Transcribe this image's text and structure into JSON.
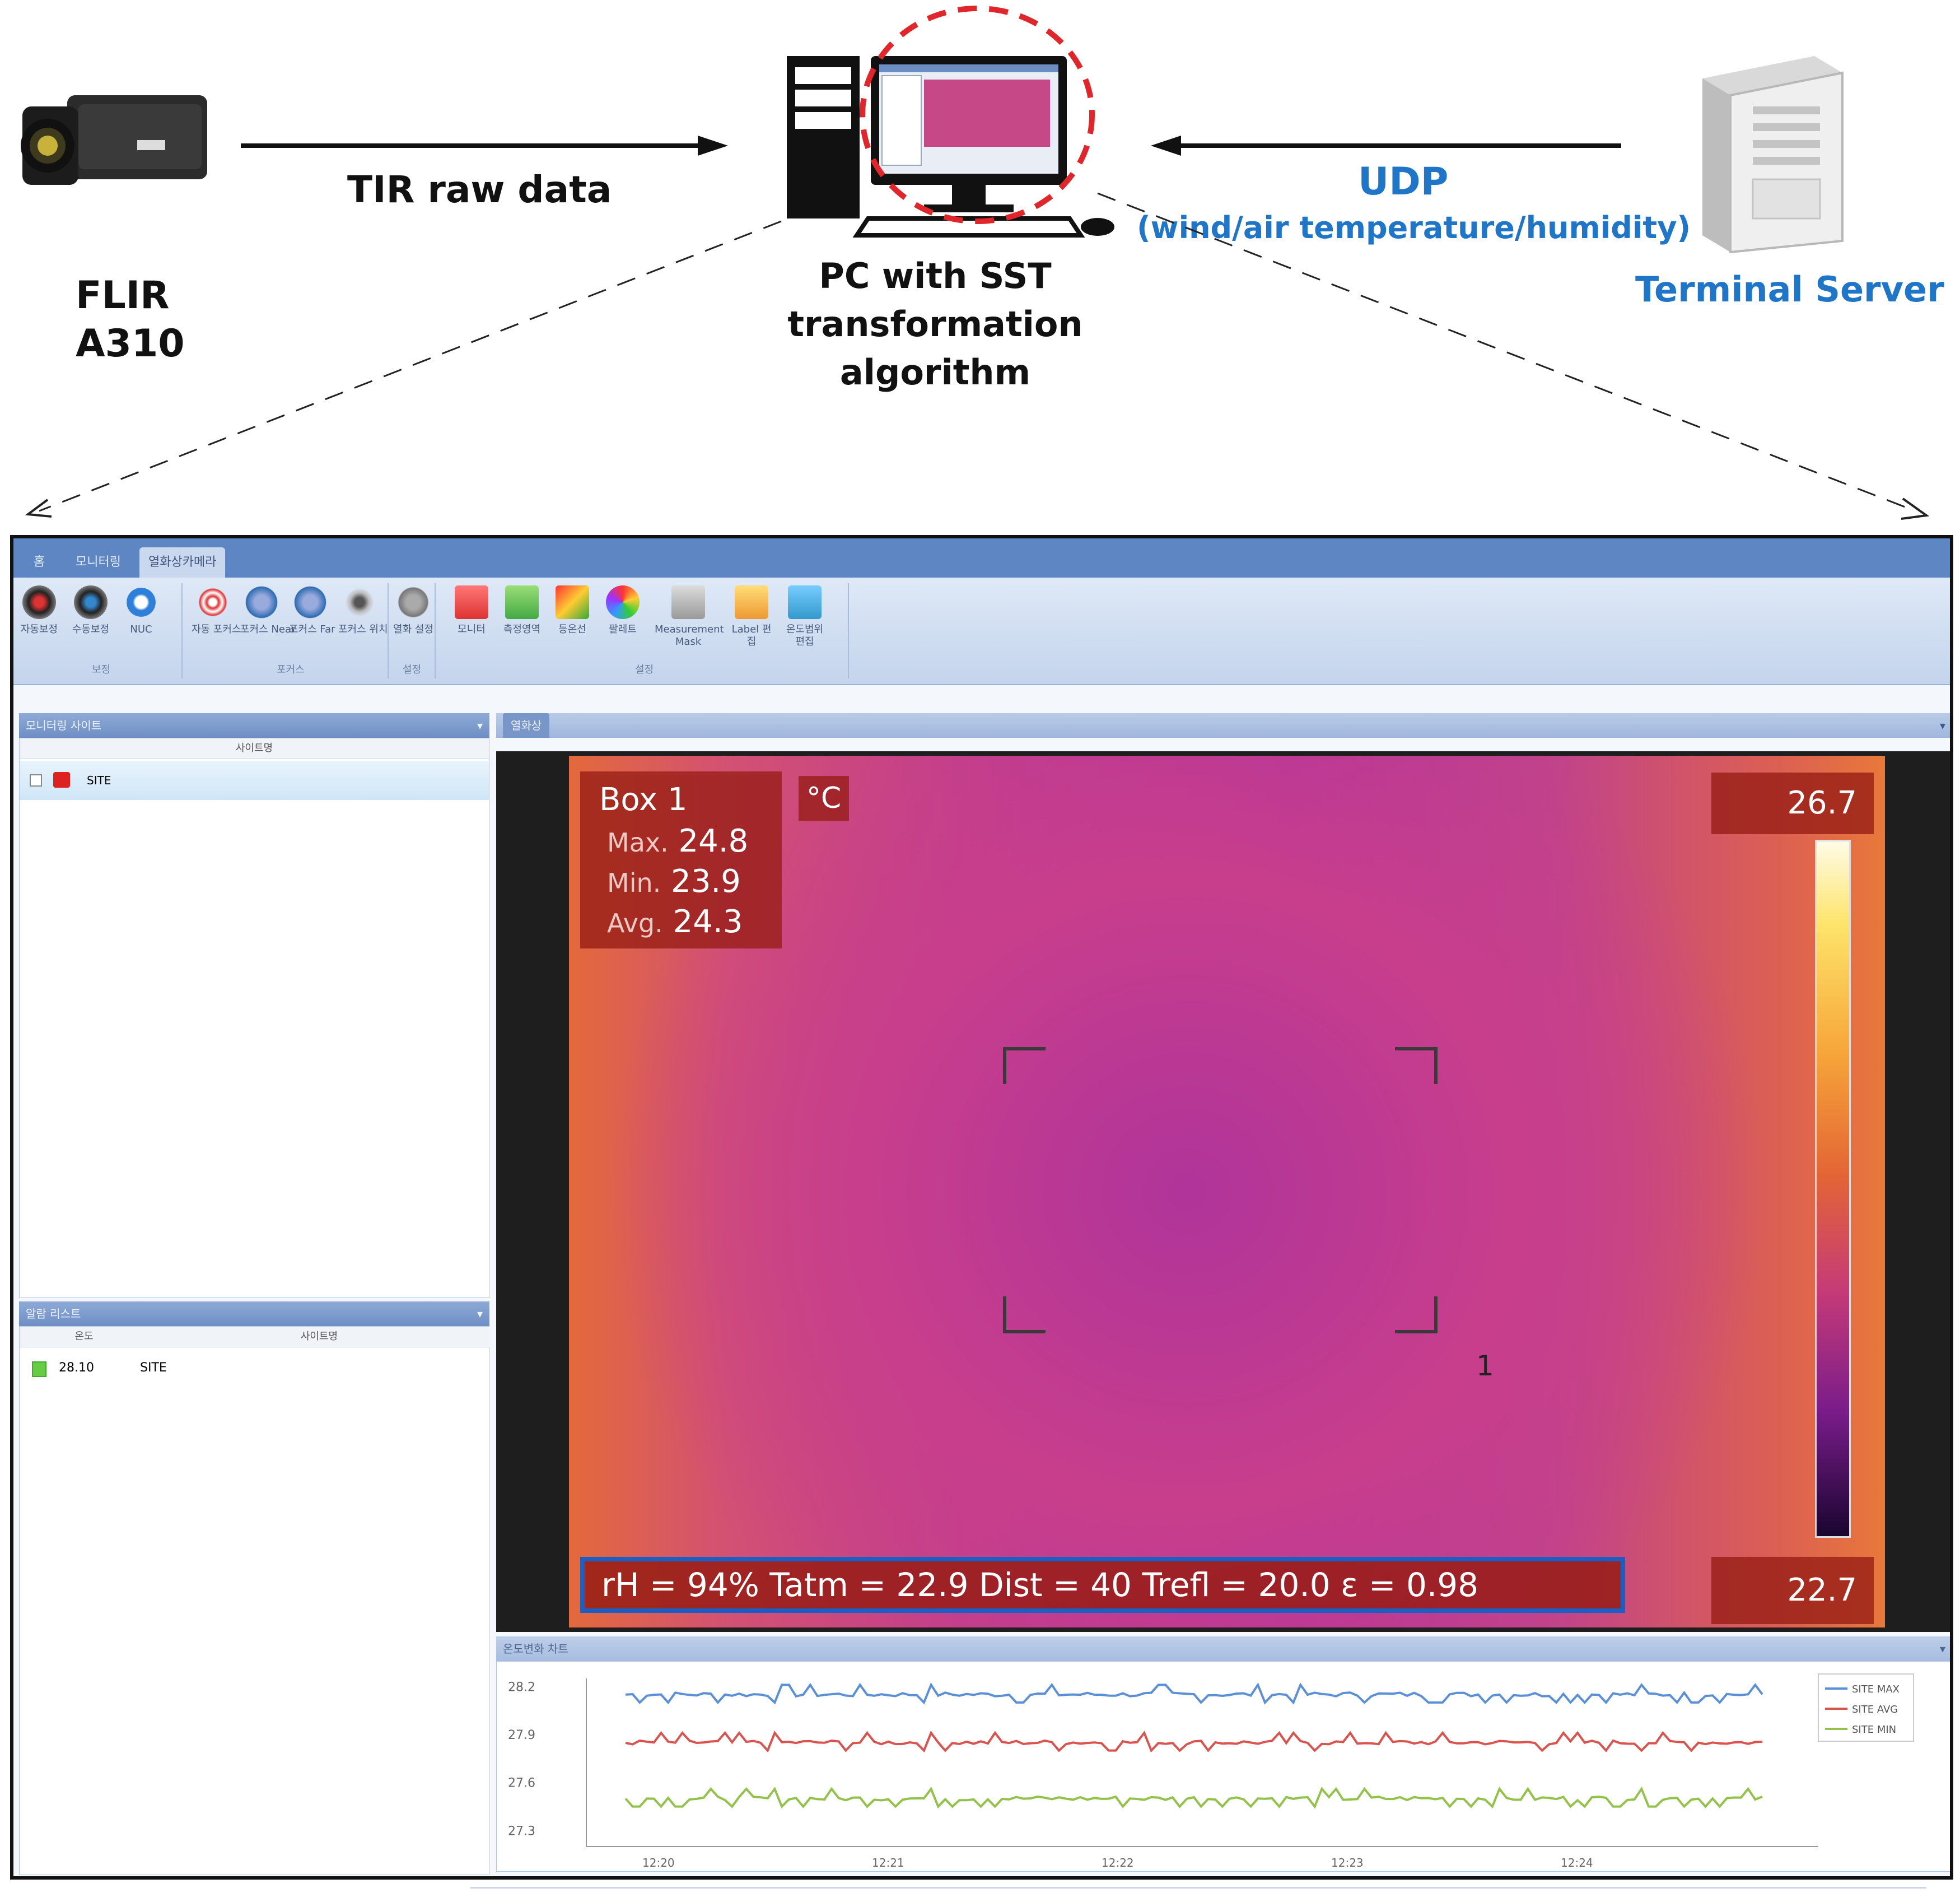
{
  "diagram": {
    "camera": {
      "name_line1": "FLIR",
      "name_line2": "A310"
    },
    "pc": {
      "line1": "PC with SST",
      "line2": "transformation",
      "line3": "algorithm"
    },
    "server": {
      "name": "Terminal Server"
    },
    "arrow_camera_to_pc": {
      "label": "TIR raw data"
    },
    "arrow_server_to_pc": {
      "label": "UDP",
      "sublabel": "(wind/air temperature/humidity)"
    }
  },
  "app": {
    "tabs": [
      "홈",
      "모니터링",
      "열화상카메라"
    ],
    "active_tab": 2,
    "ribbon": {
      "buttons": [
        "자동보정",
        "수동보정",
        "NUC",
        "자동 포커스",
        "포커스 Near",
        "포커스 Far",
        "포커스 위치",
        "열화 설정",
        "모니터",
        "측정영역",
        "등온선",
        "팔레트",
        "Measurement Mask",
        "Label 편집",
        "온도범위 편집"
      ],
      "groups": [
        "보정",
        "포커스",
        "설정",
        "설정"
      ]
    },
    "site_panel": {
      "title": "모니터링 사이트",
      "column": "사이트명",
      "rows": [
        {
          "name": "SITE"
        }
      ]
    },
    "alarm_panel": {
      "title": "알람 리스트",
      "columns": [
        "온도",
        "사이트명"
      ],
      "rows": [
        {
          "temp": "28.10",
          "site": "SITE"
        }
      ]
    },
    "view_tab": "열화상",
    "thermal": {
      "box_title": "Box 1",
      "unit": "°C",
      "max_label": "Max.",
      "max_value": "24.8",
      "min_label": "Min.",
      "min_value": "23.9",
      "avg_label": "Avg.",
      "avg_value": "24.3",
      "scale_max": "26.7",
      "scale_min": "22.7",
      "region_label": "1",
      "params": "rH = 94%  Tatm = 22.9  Dist = 40  Trefl = 20.0  ε = 0.98"
    },
    "trend_panel": {
      "title": "온도변화 차트"
    }
  },
  "chart_data": {
    "type": "line",
    "y_ticks": [
      "28.2",
      "27.9",
      "27.6",
      "27.3"
    ],
    "x_ticks": [
      "12:20",
      "12:21",
      "12:22",
      "12:23",
      "12:24"
    ],
    "legend": [
      "SITE MAX",
      "SITE AVG",
      "SITE MIN"
    ],
    "colors": [
      "#5b8fd6",
      "#d9534f",
      "#93c24a"
    ],
    "series_base": [
      28.15,
      27.85,
      27.5
    ]
  }
}
